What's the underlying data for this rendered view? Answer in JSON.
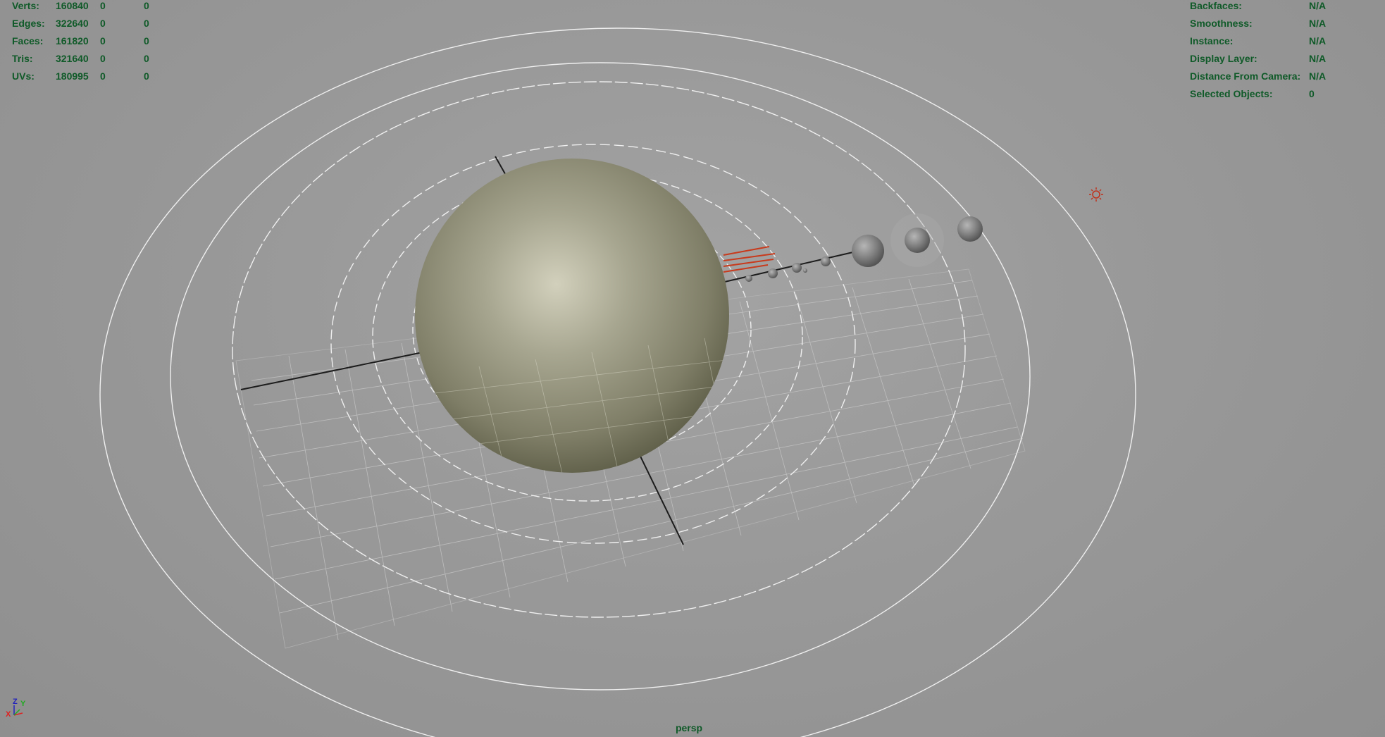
{
  "stats": [
    {
      "label": "Verts:",
      "total": "160840",
      "selected": "0",
      "component": "0"
    },
    {
      "label": "Edges:",
      "total": "322640",
      "selected": "0",
      "component": "0"
    },
    {
      "label": "Faces:",
      "total": "161820",
      "selected": "0",
      "component": "0"
    },
    {
      "label": "Tris:",
      "total": "321640",
      "selected": "0",
      "component": "0"
    },
    {
      "label": "UVs:",
      "total": "180995",
      "selected": "0",
      "component": "0"
    }
  ],
  "object_info": [
    {
      "label": "Backfaces:",
      "value": "N/A"
    },
    {
      "label": "Smoothness:",
      "value": "N/A"
    },
    {
      "label": "Instance:",
      "value": "N/A"
    },
    {
      "label": "Display Layer:",
      "value": "N/A"
    },
    {
      "label": "Distance From Camera:",
      "value": "N/A"
    },
    {
      "label": "Selected Objects:",
      "value": "0"
    }
  ],
  "camera": {
    "name": "persp"
  },
  "axis_gizmo": {
    "x_label": "X",
    "y_label": "Y",
    "z_label": "Z"
  },
  "colors": {
    "hud_text": "#0f5a28",
    "viewport_bg": "#9b9b9b",
    "sun_light": "#d9d4b8",
    "sun_dark": "#55553f",
    "planet": "#8a8a8a",
    "light_icon": "#c0301a",
    "orbit_line": "#f2f2f2",
    "grid_line": "#c8c8c8",
    "axis_line": "#1a1a1a"
  },
  "icons": [
    "directional-light-icon",
    "axis-gizmo-icon"
  ]
}
